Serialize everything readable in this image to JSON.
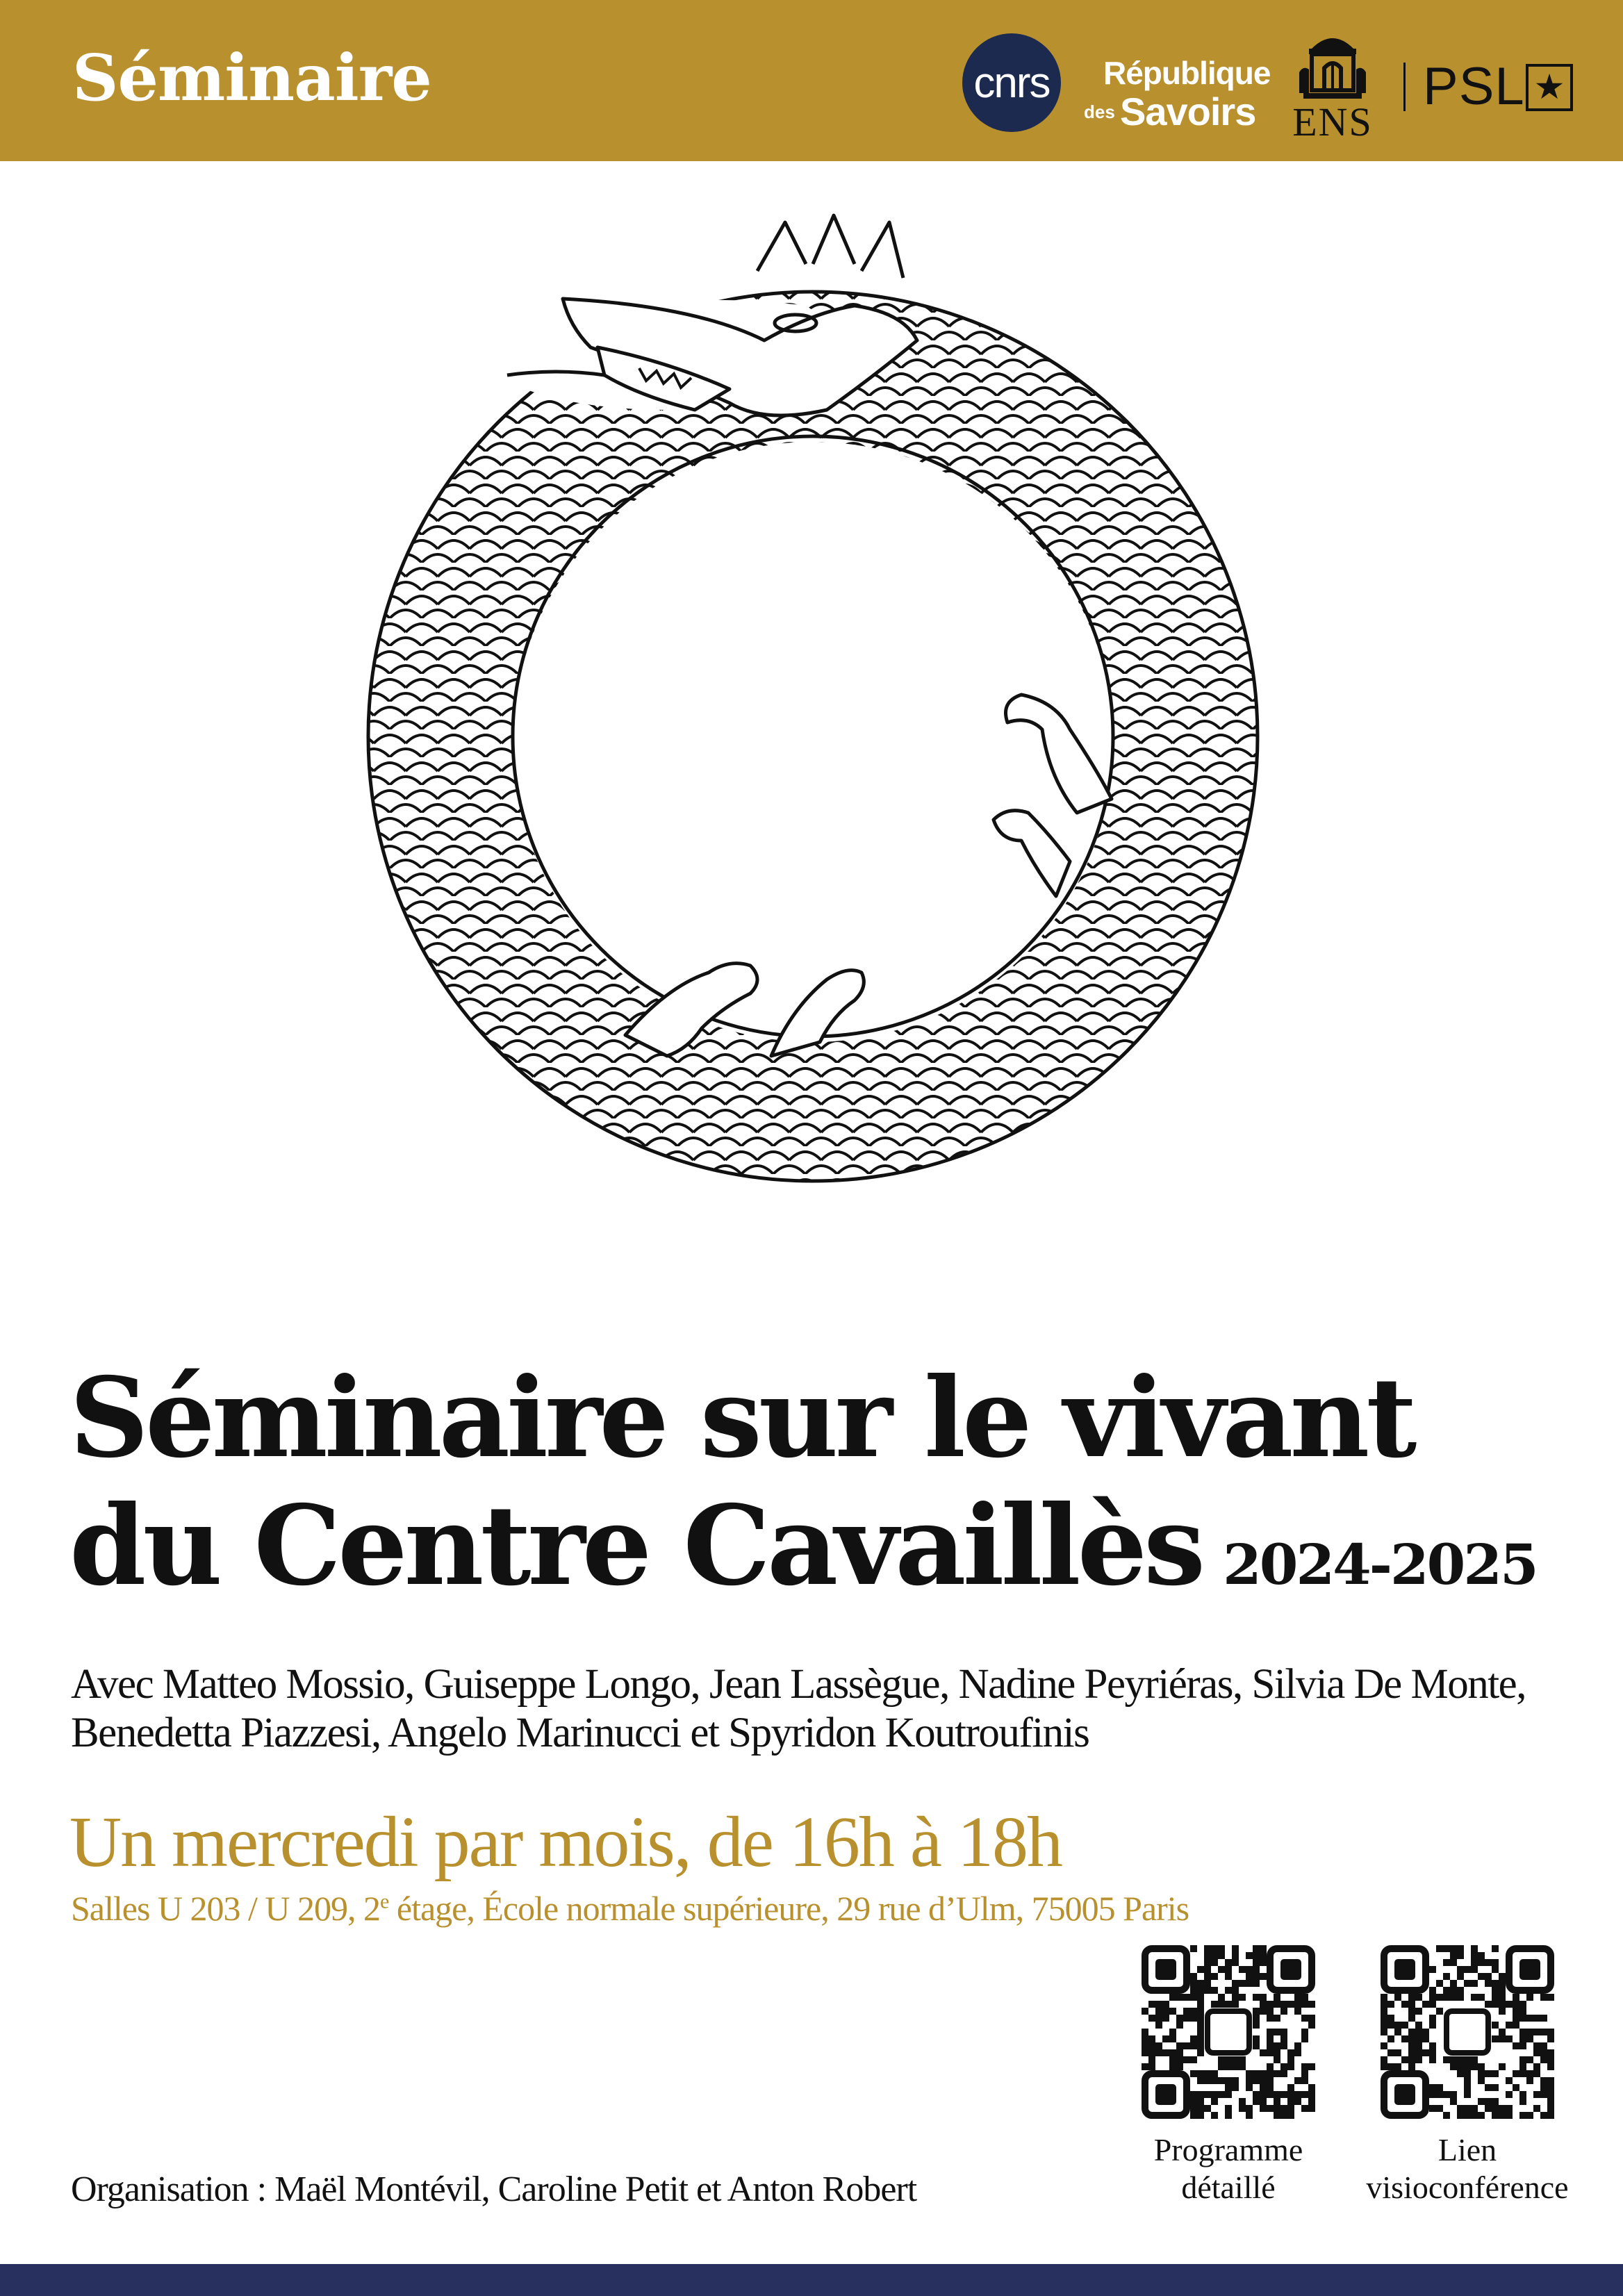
{
  "banner": {
    "title": "Séminaire",
    "logos": {
      "cnrs": "cnrs",
      "republique_line1": "République",
      "republique_des": "des",
      "republique_savoirs": "Savoirs",
      "ens": "ENS",
      "psl": "PSL"
    }
  },
  "title": {
    "line1": "Séminaire sur le vivant",
    "line2": "du Centre Cavaillès",
    "year": "2024-2025"
  },
  "speakers": {
    "line1": "Avec Matteo Mossio, Guiseppe Longo, Jean Lassègue, Nadine Peyriéras, Silvia De Monte,",
    "line2": "Benedetta Piazzesi, Angelo Marinucci et Spyridon Koutroufinis"
  },
  "schedule": "Un mercredi par mois, de 16h à 18h",
  "venue": {
    "before": "Salles U 203 / U 209, 2",
    "sup": "e",
    "after": " étage, École normale supérieure, 29 rue d’Ulm, 75005 Paris"
  },
  "qr_codes": [
    {
      "caption_line1": "Programme",
      "caption_line2": "détaillé"
    },
    {
      "caption_line1": "Lien",
      "caption_line2": "visioconférence"
    }
  ],
  "organisation": "Organisation : Maël Montévil, Caroline Petit et Anton Robert",
  "colors": {
    "gold": "#b8912e",
    "navy": "#27305e",
    "cnrs_blue": "#1d2a4f"
  }
}
